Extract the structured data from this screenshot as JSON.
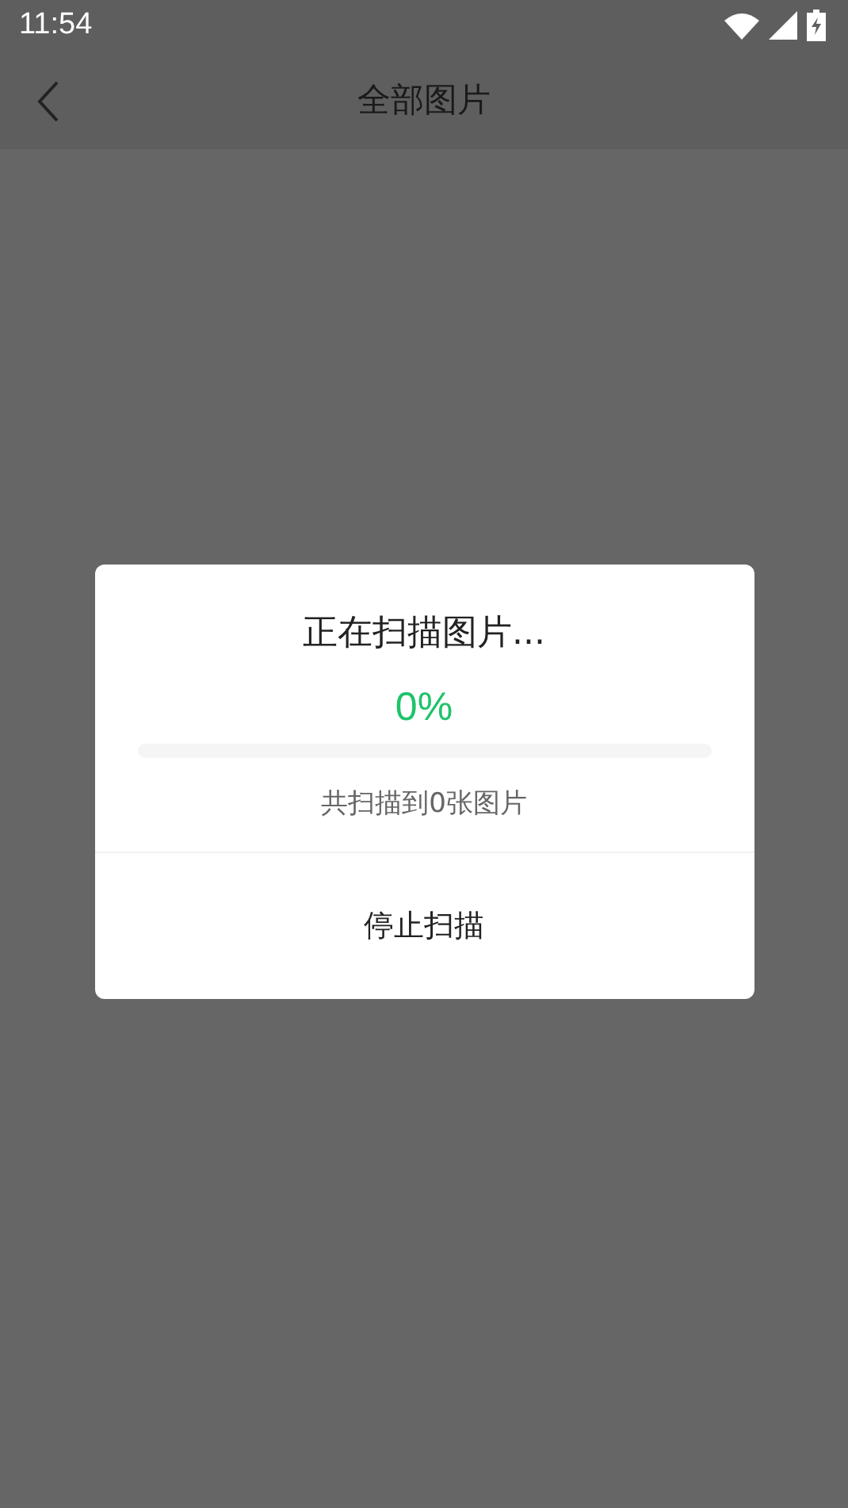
{
  "status_bar": {
    "time": "11:54"
  },
  "header": {
    "title": "全部图片"
  },
  "dialog": {
    "title": "正在扫描图片...",
    "percent": "0%",
    "progress": {
      "level": 0
    },
    "count": "共扫描到0张图片",
    "button": "停止扫描"
  }
}
